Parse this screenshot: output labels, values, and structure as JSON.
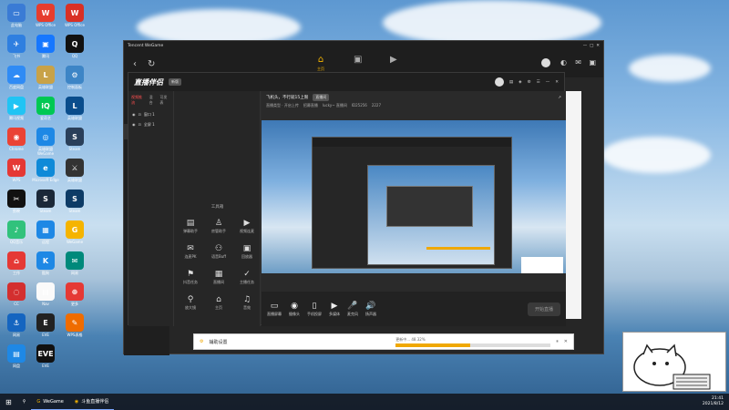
{
  "desktop": {
    "icons": [
      {
        "label": "此电脑",
        "color": "#3a7bd5",
        "glyph": "▭"
      },
      {
        "label": "WPS Office",
        "color": "#e63d2e",
        "glyph": "W"
      },
      {
        "label": "WPS Office",
        "color": "#d93025",
        "glyph": "W"
      },
      {
        "label": "飞书",
        "color": "#2f7fe0",
        "glyph": "✈"
      },
      {
        "label": "腾讯",
        "color": "#1677ff",
        "glyph": "▣"
      },
      {
        "label": "QQ",
        "color": "#111",
        "glyph": "Q"
      },
      {
        "label": "百度网盘",
        "color": "#2f8bf5",
        "glyph": "☁"
      },
      {
        "label": "英雄联盟",
        "color": "#c8a248",
        "glyph": "L"
      },
      {
        "label": "控制面板",
        "color": "#3d85c6",
        "glyph": "⚙"
      },
      {
        "label": "腾讯视频",
        "color": "#20c4f4",
        "glyph": "▶"
      },
      {
        "label": "爱奇艺",
        "color": "#00c853",
        "glyph": "iQ"
      },
      {
        "label": "英雄联盟",
        "color": "#0a4d8c",
        "glyph": "L"
      },
      {
        "label": "Chrome",
        "color": "#ea4335",
        "glyph": "◉"
      },
      {
        "label": "英雄联盟WeGame",
        "color": "#1e88e5",
        "glyph": "◎"
      },
      {
        "label": "Steam",
        "color": "#2a3f5a",
        "glyph": "S"
      },
      {
        "label": "WPS",
        "color": "#e53935",
        "glyph": "W"
      },
      {
        "label": "Microsoft Edge",
        "color": "#0f8ad8",
        "glyph": "e"
      },
      {
        "label": "英雄联盟",
        "color": "#333",
        "glyph": "⚔"
      },
      {
        "label": "剪映",
        "color": "#111",
        "glyph": "✂"
      },
      {
        "label": "Steam",
        "color": "#1b2838",
        "glyph": "S"
      },
      {
        "label": "Steam",
        "color": "#0d3b66",
        "glyph": "S"
      },
      {
        "label": "QQ音乐",
        "color": "#31c27c",
        "glyph": "♪"
      },
      {
        "label": "远程",
        "color": "#1e88e5",
        "glyph": "▦"
      },
      {
        "label": "WeGame",
        "color": "#f5b400",
        "glyph": "G"
      },
      {
        "label": "工作",
        "color": "#e53935",
        "glyph": "⌂"
      },
      {
        "label": "酷狗",
        "color": "#1e88e5",
        "glyph": "K"
      },
      {
        "label": "网易",
        "color": "#00897b",
        "glyph": "✉"
      },
      {
        "label": "CC",
        "color": "#d32f2f",
        "glyph": "◌"
      },
      {
        "label": "Nav",
        "color": "#fafafa",
        "glyph": "▤"
      },
      {
        "label": "更多",
        "color": "#e53935",
        "glyph": "⊕"
      },
      {
        "label": "网易",
        "color": "#1565c0",
        "glyph": "⚓"
      },
      {
        "label": "EVE",
        "color": "#222",
        "glyph": "E"
      },
      {
        "label": "WPS表格",
        "color": "#ef6c00",
        "glyph": "✎"
      },
      {
        "label": "网盘",
        "color": "#1e88e5",
        "glyph": "▤"
      },
      {
        "label": "EVE",
        "color": "#111",
        "glyph": "EVE"
      }
    ]
  },
  "wegame": {
    "title": "Tencent WeGame",
    "top_tabs": [
      {
        "label": "主页",
        "glyph": "⌂",
        "active": true
      },
      {
        "label": "",
        "glyph": "▣",
        "active": false
      },
      {
        "label": "",
        "glyph": "▶",
        "active": false
      }
    ],
    "left_nav": [
      {
        "label": "个人主页",
        "color": "#555"
      },
      {
        "label": "英雄联盟",
        "color": "#c8a248"
      },
      {
        "label": "",
        "color": "#888"
      },
      {
        "label": "英雄联盟",
        "color": "#c8a248"
      },
      {
        "label": "英雄联盟",
        "color": "#2a6cb0"
      },
      {
        "label": "",
        "color": "#b33"
      },
      {
        "label": "",
        "color": "#444"
      },
      {
        "label": "",
        "color": "#777"
      },
      {
        "label": "QQ飞车",
        "color": "#3a7bd5"
      },
      {
        "label": "",
        "color": "#555"
      }
    ]
  },
  "live_app": {
    "logo": "直播伴侣",
    "beta_badge": "新版",
    "scene_tabs": [
      "视频推流",
      "混合",
      "可发表"
    ],
    "scenes": [
      {
        "label": "窗口 1"
      },
      {
        "label": "全屏 1"
      }
    ],
    "tools_header": "工具箱",
    "tools": [
      {
        "label": "弹幕助手",
        "glyph": "▤"
      },
      {
        "label": "房管助手",
        "glyph": "♙"
      },
      {
        "label": "视频连麦",
        "glyph": "▶"
      },
      {
        "label": "连麦PK",
        "glyph": "✉"
      },
      {
        "label": "语音Buff",
        "glyph": "⚇"
      },
      {
        "label": "回放器",
        "glyph": "▣"
      },
      {
        "label": "抖音任务",
        "glyph": "⚑"
      },
      {
        "label": "直播间",
        "glyph": "▦"
      },
      {
        "label": "主播任务",
        "glyph": "✓"
      },
      {
        "label": "放大镜",
        "glyph": "⚲"
      },
      {
        "label": "主页",
        "glyph": "⌂"
      },
      {
        "label": "音效",
        "glyph": "♫"
      }
    ],
    "stream_title": "飞机头，不行就15上限",
    "edit_label": "编辑",
    "room_tag": "直播间",
    "meta_items": [
      "直播类型 · 开启上传",
      "招募直播",
      "lucky~ 直播间",
      "ID25256",
      "2227"
    ],
    "bottom_buttons": [
      {
        "label": "直播屏幕",
        "glyph": "▭"
      },
      {
        "label": "摄像头",
        "glyph": "◉"
      },
      {
        "label": "手机投屏",
        "glyph": "▯"
      },
      {
        "label": "多媒体",
        "glyph": "▶"
      },
      {
        "label": "麦克风",
        "glyph": "🎤"
      },
      {
        "label": "扬声器",
        "glyph": "🔊"
      }
    ],
    "start_live": "开始直播"
  },
  "progress": {
    "label": "辅助设置",
    "status": "更新中...",
    "percent_text": "48.32%",
    "fraction": 0.4832
  },
  "taskbar": {
    "items": [
      {
        "label": "WeGame",
        "glyph": "G"
      },
      {
        "label": "斗鱼直播伴侣",
        "glyph": "◉"
      }
    ],
    "time": "21:41",
    "date": "2021/8/12"
  },
  "colors": {
    "accent": "#f5b400",
    "danger": "#ff4f4f",
    "panel": "#262626"
  }
}
